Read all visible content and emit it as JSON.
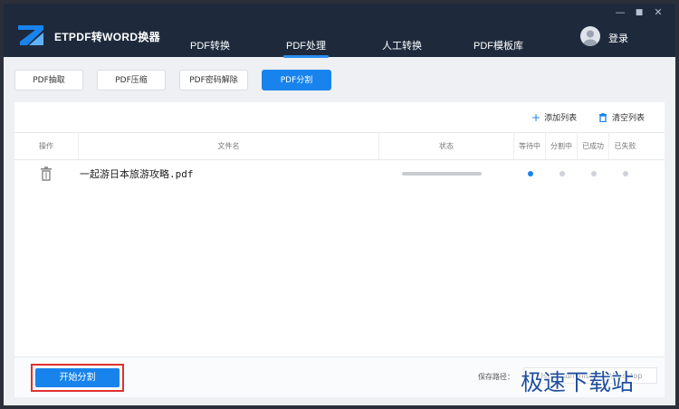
{
  "app": {
    "title": "ETPDF转WORD换器",
    "login_label": "登录",
    "accent_color": "#1883ec"
  },
  "window_controls": {
    "minimize": "—",
    "maximize": "■",
    "close": "✕"
  },
  "nav": {
    "tabs": [
      {
        "label": "PDF转换"
      },
      {
        "label": "PDF处理",
        "active": true
      },
      {
        "label": "人工转换"
      },
      {
        "label": "PDF模板库"
      }
    ]
  },
  "functions": {
    "buttons": [
      {
        "label": "PDF抽取"
      },
      {
        "label": "PDF压缩"
      },
      {
        "label": "PDF密码解除"
      },
      {
        "label": "PDF分割",
        "active": true
      }
    ]
  },
  "toolbar": {
    "add_label": "添加列表",
    "clear_label": "清空列表"
  },
  "table": {
    "columns": [
      "操作",
      "文件名",
      "状态",
      "等待中",
      "分割中",
      "已成功",
      "已失败"
    ],
    "rows": [
      {
        "filename": "一起游日本旅游攻略.pdf",
        "status_progress": 0,
        "stage": "等待中"
      }
    ]
  },
  "footer": {
    "start_label": "开始分割",
    "save_path_label": "保存路径：",
    "save_path_value": "C:\\Users\\Administrator\\Desktop"
  },
  "watermark": "极速下载站"
}
